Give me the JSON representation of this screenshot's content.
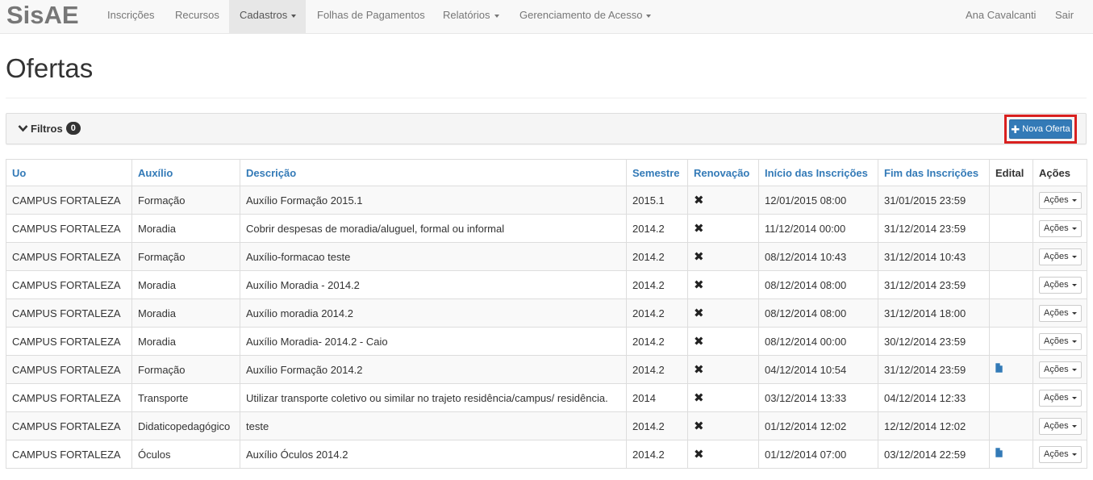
{
  "nav": {
    "brand": "SisAE",
    "items": [
      {
        "label": "Inscrições"
      },
      {
        "label": "Recursos"
      },
      {
        "label": "Cadastros"
      },
      {
        "label": "Folhas de Pagamentos"
      },
      {
        "label": "Relatórios"
      },
      {
        "label": "Gerenciamento de Acesso"
      }
    ],
    "user": "Ana Cavalcanti",
    "logout": "Sair"
  },
  "page": {
    "title": "Ofertas"
  },
  "filters": {
    "label": "Filtros",
    "count": "0",
    "new_button": "Nova Oferta",
    "new_button_highlight": "#d9201f"
  },
  "table": {
    "headers": {
      "uo": "Uo",
      "auxilio": "Auxílio",
      "descricao": "Descrição",
      "semestre": "Semestre",
      "renovacao": "Renovação",
      "inicio": "Início das Inscrições",
      "fim": "Fim das Inscrições",
      "edital": "Edital",
      "acoes": "Ações"
    },
    "renovacao_symbol": "✖",
    "actions_label": "Ações",
    "rows": [
      {
        "uo": "CAMPUS FORTALEZA",
        "auxilio": "Formação",
        "descricao": "Auxílio Formação 2015.1",
        "semestre": "2015.1",
        "inicio": "12/01/2015 08:00",
        "fim": "31/01/2015 23:59",
        "edital": false
      },
      {
        "uo": "CAMPUS FORTALEZA",
        "auxilio": "Moradia",
        "descricao": "Cobrir despesas de moradia/aluguel, formal ou informal",
        "semestre": "2014.2",
        "inicio": "11/12/2014 00:00",
        "fim": "31/12/2014 23:59",
        "edital": false
      },
      {
        "uo": "CAMPUS FORTALEZA",
        "auxilio": "Formação",
        "descricao": "Auxílio-formacao teste",
        "semestre": "2014.2",
        "inicio": "08/12/2014 10:43",
        "fim": "31/12/2014 10:43",
        "edital": false
      },
      {
        "uo": "CAMPUS FORTALEZA",
        "auxilio": "Moradia",
        "descricao": "Auxílio Moradia - 2014.2",
        "semestre": "2014.2",
        "inicio": "08/12/2014 08:00",
        "fim": "31/12/2014 23:59",
        "edital": false
      },
      {
        "uo": "CAMPUS FORTALEZA",
        "auxilio": "Moradia",
        "descricao": "Auxílio moradia 2014.2",
        "semestre": "2014.2",
        "inicio": "08/12/2014 08:00",
        "fim": "31/12/2014 18:00",
        "edital": false
      },
      {
        "uo": "CAMPUS FORTALEZA",
        "auxilio": "Moradia",
        "descricao": "Auxílio Moradia- 2014.2 - Caio",
        "semestre": "2014.2",
        "inicio": "08/12/2014 00:00",
        "fim": "30/12/2014 23:59",
        "edital": false
      },
      {
        "uo": "CAMPUS FORTALEZA",
        "auxilio": "Formação",
        "descricao": "Auxílio Formação 2014.2",
        "semestre": "2014.2",
        "inicio": "04/12/2014 10:54",
        "fim": "31/12/2014 23:59",
        "edital": true
      },
      {
        "uo": "CAMPUS FORTALEZA",
        "auxilio": "Transporte",
        "descricao": "Utilizar transporte coletivo ou similar no trajeto residência/campus/ residência.",
        "semestre": "2014",
        "inicio": "03/12/2014 13:33",
        "fim": "04/12/2014 12:33",
        "edital": false
      },
      {
        "uo": "CAMPUS FORTALEZA",
        "auxilio": "Didaticopedagógico",
        "descricao": "teste",
        "semestre": "2014.2",
        "inicio": "01/12/2014 12:02",
        "fim": "12/12/2014 12:02",
        "edital": false
      },
      {
        "uo": "CAMPUS FORTALEZA",
        "auxilio": "Óculos",
        "descricao": "Auxílio Óculos 2014.2",
        "semestre": "2014.2",
        "inicio": "01/12/2014 07:00",
        "fim": "03/12/2014 22:59",
        "edital": true
      }
    ]
  },
  "colors": {
    "link": "#337ab7",
    "primary_button": "#337ab7",
    "navbar_bg": "#f8f8f8",
    "brand_text": "#777777"
  },
  "icons": {
    "filters_toggle": "chevron-down-icon",
    "new_button": "plus-icon",
    "renovacao": "x-mark-icon",
    "edital": "file-icon"
  }
}
